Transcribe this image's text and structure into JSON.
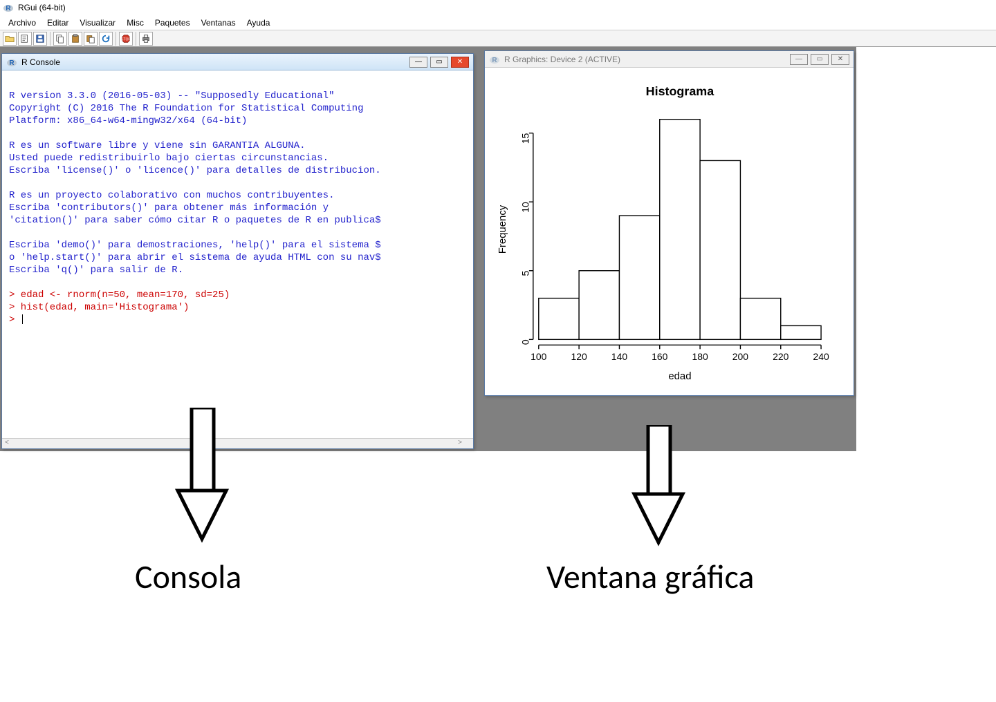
{
  "app": {
    "title": "RGui (64-bit)"
  },
  "menu": {
    "items": [
      "Archivo",
      "Editar",
      "Visualizar",
      "Misc",
      "Paquetes",
      "Ventanas",
      "Ayuda"
    ]
  },
  "toolbar": {
    "icons": [
      "open",
      "source",
      "save",
      "copy",
      "paste",
      "copy-paste",
      "refresh",
      "stop",
      "print"
    ]
  },
  "console": {
    "title": "R Console",
    "lines": [
      "",
      "R version 3.3.0 (2016-05-03) -- \"Supposedly Educational\"",
      "Copyright (C) 2016 The R Foundation for Statistical Computing",
      "Platform: x86_64-w64-mingw32/x64 (64-bit)",
      "",
      "R es un software libre y viene sin GARANTIA ALGUNA.",
      "Usted puede redistribuirlo bajo ciertas circunstancias.",
      "Escriba 'license()' o 'licence()' para detalles de distribucion.",
      "",
      "R es un proyecto colaborativo con muchos contribuyentes.",
      "Escriba 'contributors()' para obtener más información y",
      "'citation()' para saber cómo citar R o paquetes de R en publica$",
      "",
      "Escriba 'demo()' para demostraciones, 'help()' para el sistema $",
      "o 'help.start()' para abrir el sistema de ayuda HTML con su nav$",
      "Escriba 'q()' para salir de R.",
      ""
    ],
    "commands": [
      "> edad <- rnorm(n=50, mean=170, sd=25)",
      "> hist(edad, main='Histograma')",
      "> "
    ]
  },
  "graphics": {
    "title": "R Graphics: Device 2 (ACTIVE)"
  },
  "chart_data": {
    "type": "bar",
    "title": "Histograma",
    "xlabel": "edad",
    "ylabel": "Frequency",
    "categories": [
      "100",
      "120",
      "140",
      "160",
      "180",
      "200",
      "220",
      "240"
    ],
    "x_breaks": [
      100,
      120,
      140,
      160,
      180,
      200,
      220,
      240
    ],
    "values": [
      3,
      5,
      9,
      16,
      13,
      3,
      1
    ],
    "ylim": [
      0,
      16
    ],
    "yticks": [
      0,
      5,
      10,
      15
    ]
  },
  "annotations": {
    "left_label": "Consola",
    "right_label": "Ventana gráfica"
  }
}
